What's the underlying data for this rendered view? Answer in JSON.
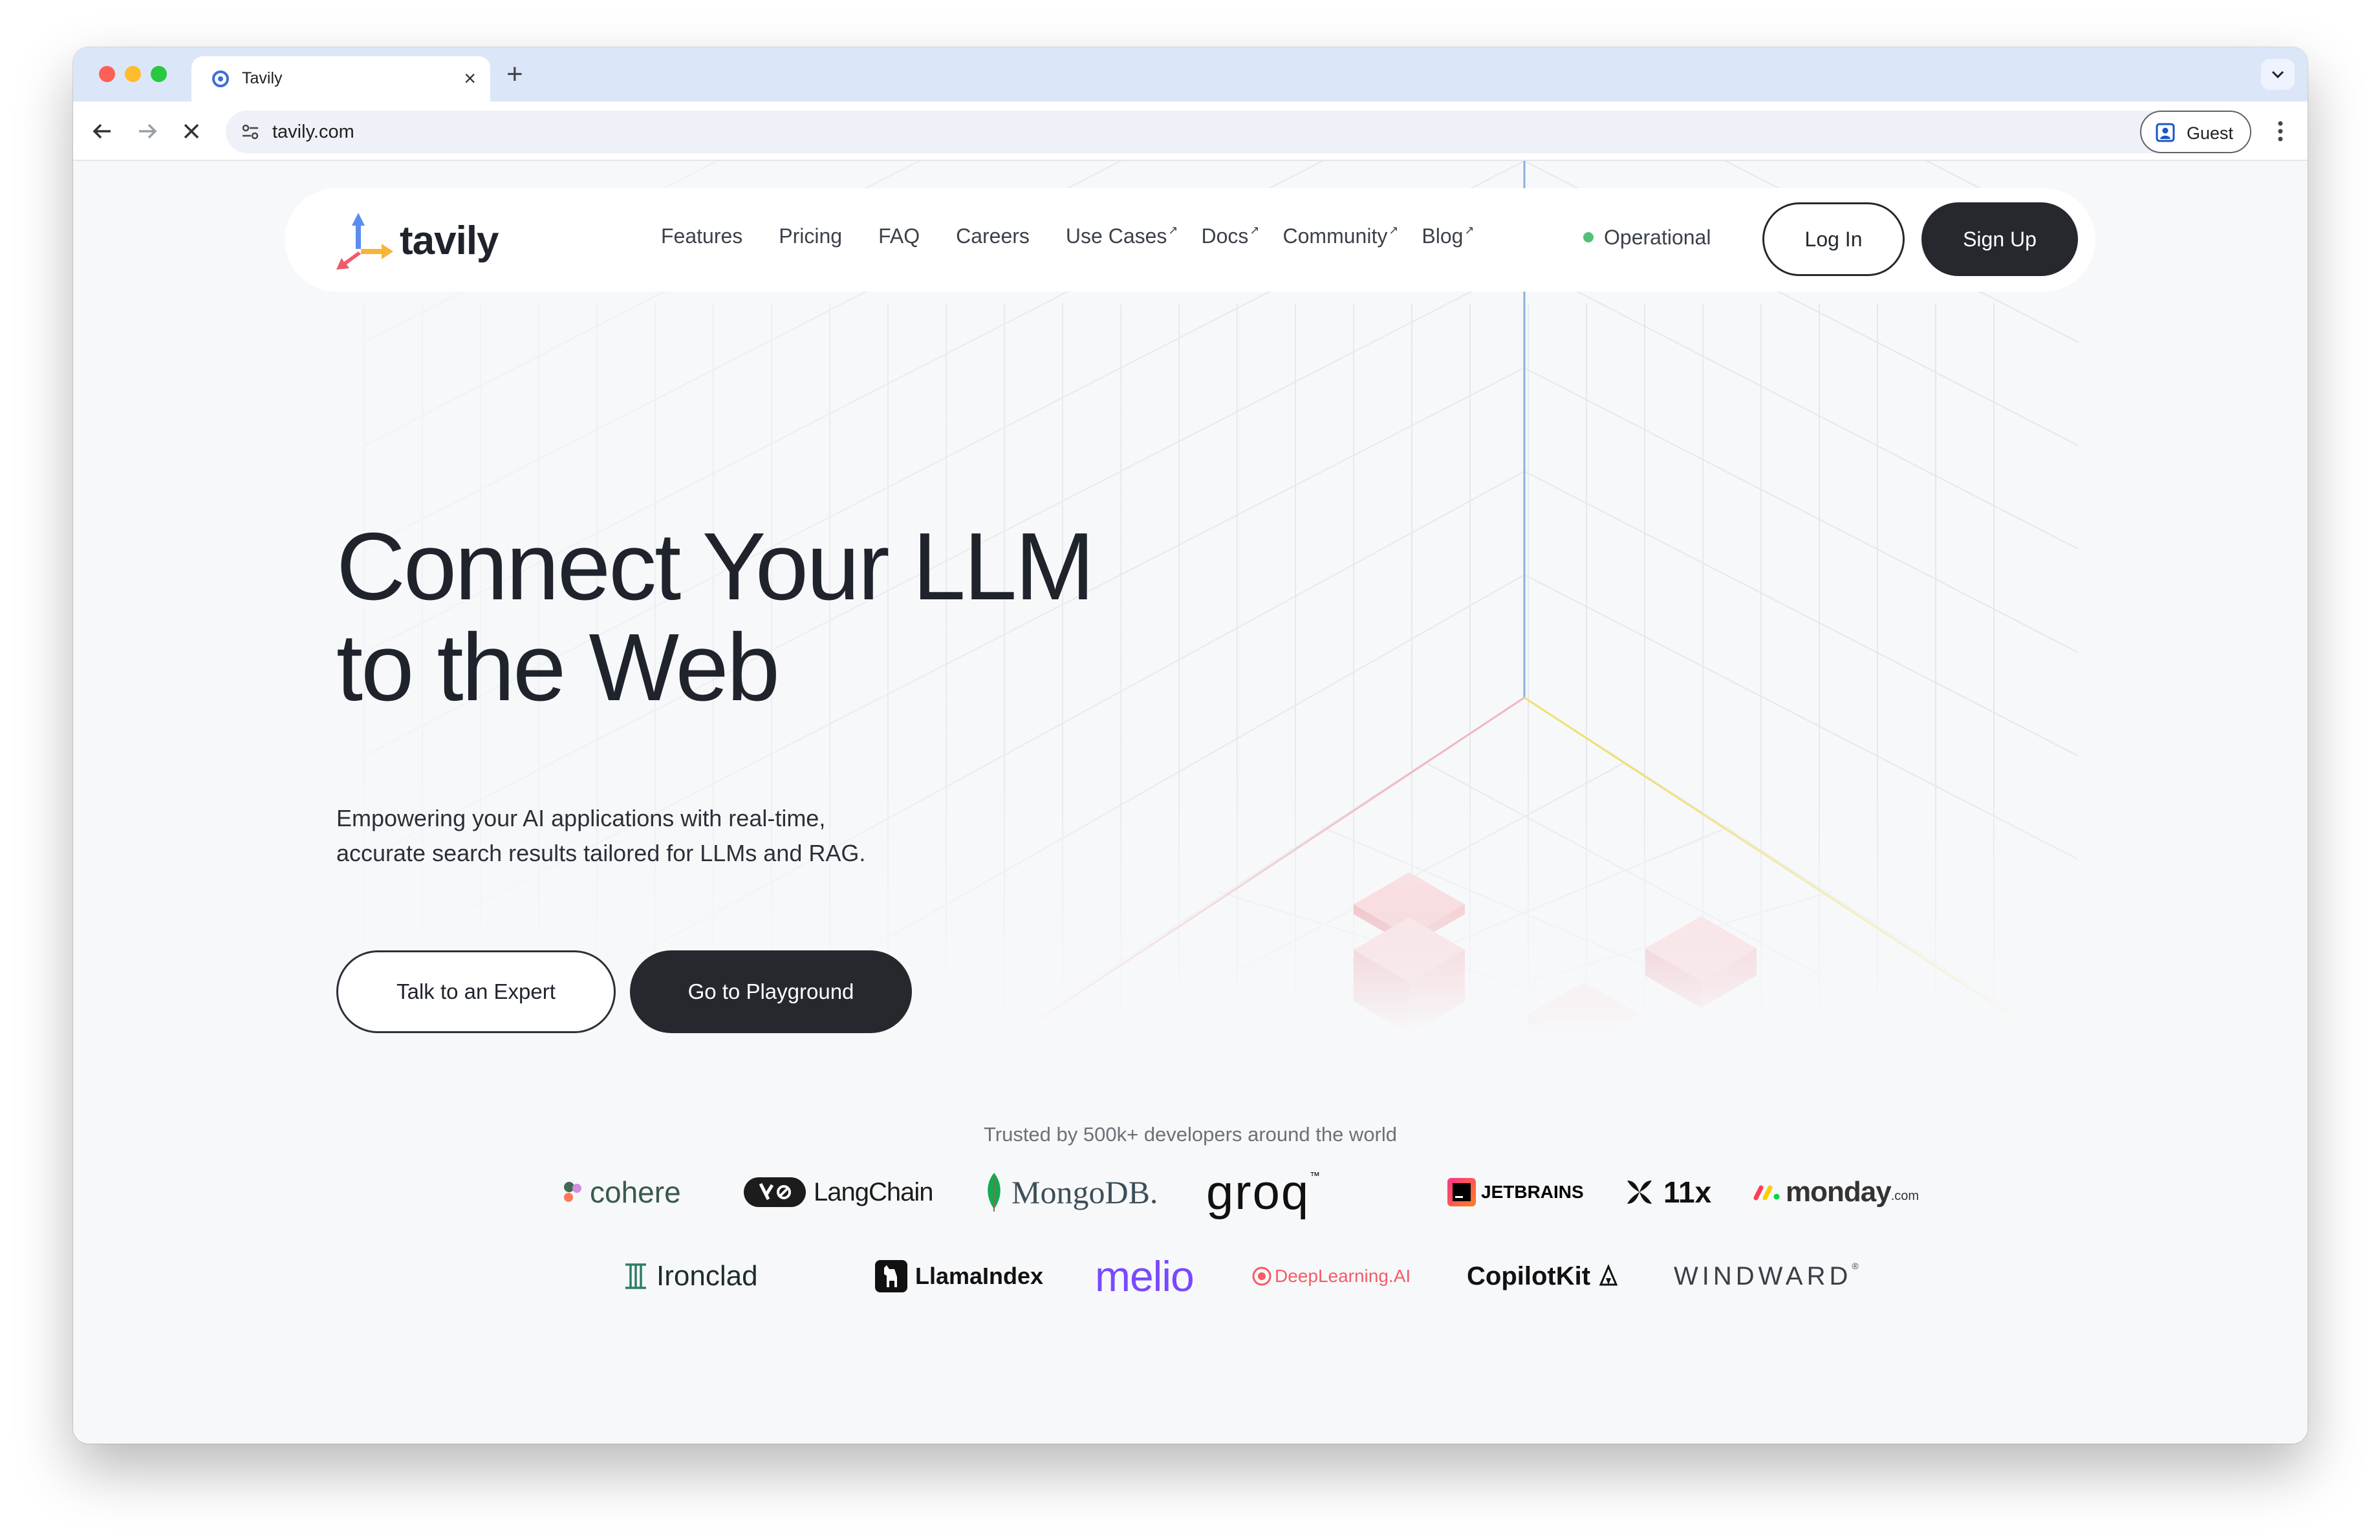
{
  "browser": {
    "tab_title": "Tavily",
    "tab_close": "×",
    "new_tab": "+",
    "url": "tavily.com",
    "profile_label": "Guest"
  },
  "nav": {
    "logo_text": "tavily",
    "links": [
      "Features",
      "Pricing",
      "FAQ",
      "Careers",
      "Use Cases",
      "Docs",
      "Community",
      "Blog"
    ],
    "status": "Operational",
    "login": "Log In",
    "signup": "Sign Up"
  },
  "hero": {
    "title_line1": "Connect Your LLM",
    "title_line2": "to the Web",
    "subtitle_line1": "Empowering your AI applications with real-time,",
    "subtitle_line2": "accurate search results tailored for LLMs and RAG.",
    "cta_secondary": "Talk to an Expert",
    "cta_primary": "Go to Playground"
  },
  "trusted": {
    "heading": "Trusted by 500k+ developers around the world",
    "row1": [
      "cohere",
      "LangChain",
      "MongoDB.",
      "groq",
      "JETBRAINS",
      "11x",
      "monday"
    ],
    "monday_suffix": ".com",
    "row2": [
      "Ironclad",
      "LlamaIndex",
      "melio",
      "DeepLearning.AI",
      "CopilotKit",
      "WINDWARD"
    ]
  },
  "colors": {
    "dark_button": "#25282d",
    "status_green": "#53c07a",
    "tabstrip": "#dce6f9",
    "cube_pink": "#f4a7ae"
  }
}
